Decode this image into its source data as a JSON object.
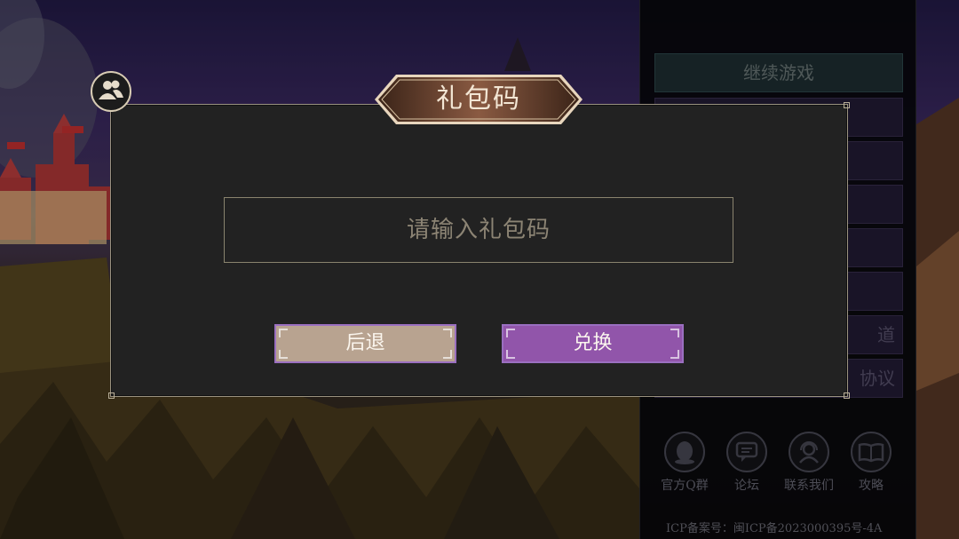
{
  "dialog": {
    "title": "礼包码",
    "input_placeholder": "请输入礼包码",
    "input_value": "",
    "back_label": "后退",
    "redeem_label": "兑换",
    "accent_colors": {
      "back": "#b8a390",
      "redeem": "#9155aa",
      "border": "#9a6fc0"
    }
  },
  "menu": {
    "items": [
      {
        "label": "继续游戏"
      },
      {
        "label": ""
      },
      {
        "label": ""
      },
      {
        "label": ""
      },
      {
        "label": ""
      },
      {
        "label": ""
      },
      {
        "label": "道"
      },
      {
        "label": "协议"
      }
    ]
  },
  "social": [
    {
      "label": "官方Q群",
      "icon": "qq-penguin-icon"
    },
    {
      "label": "论坛",
      "icon": "chat-bubble-icon"
    },
    {
      "label": "联系我们",
      "icon": "support-agent-icon"
    },
    {
      "label": "攻略",
      "icon": "open-book-icon"
    }
  ],
  "footer": {
    "icp": "ICP备案号：闽ICP备2023000395号-4A"
  },
  "icons": {
    "account": "user-group-icon"
  }
}
